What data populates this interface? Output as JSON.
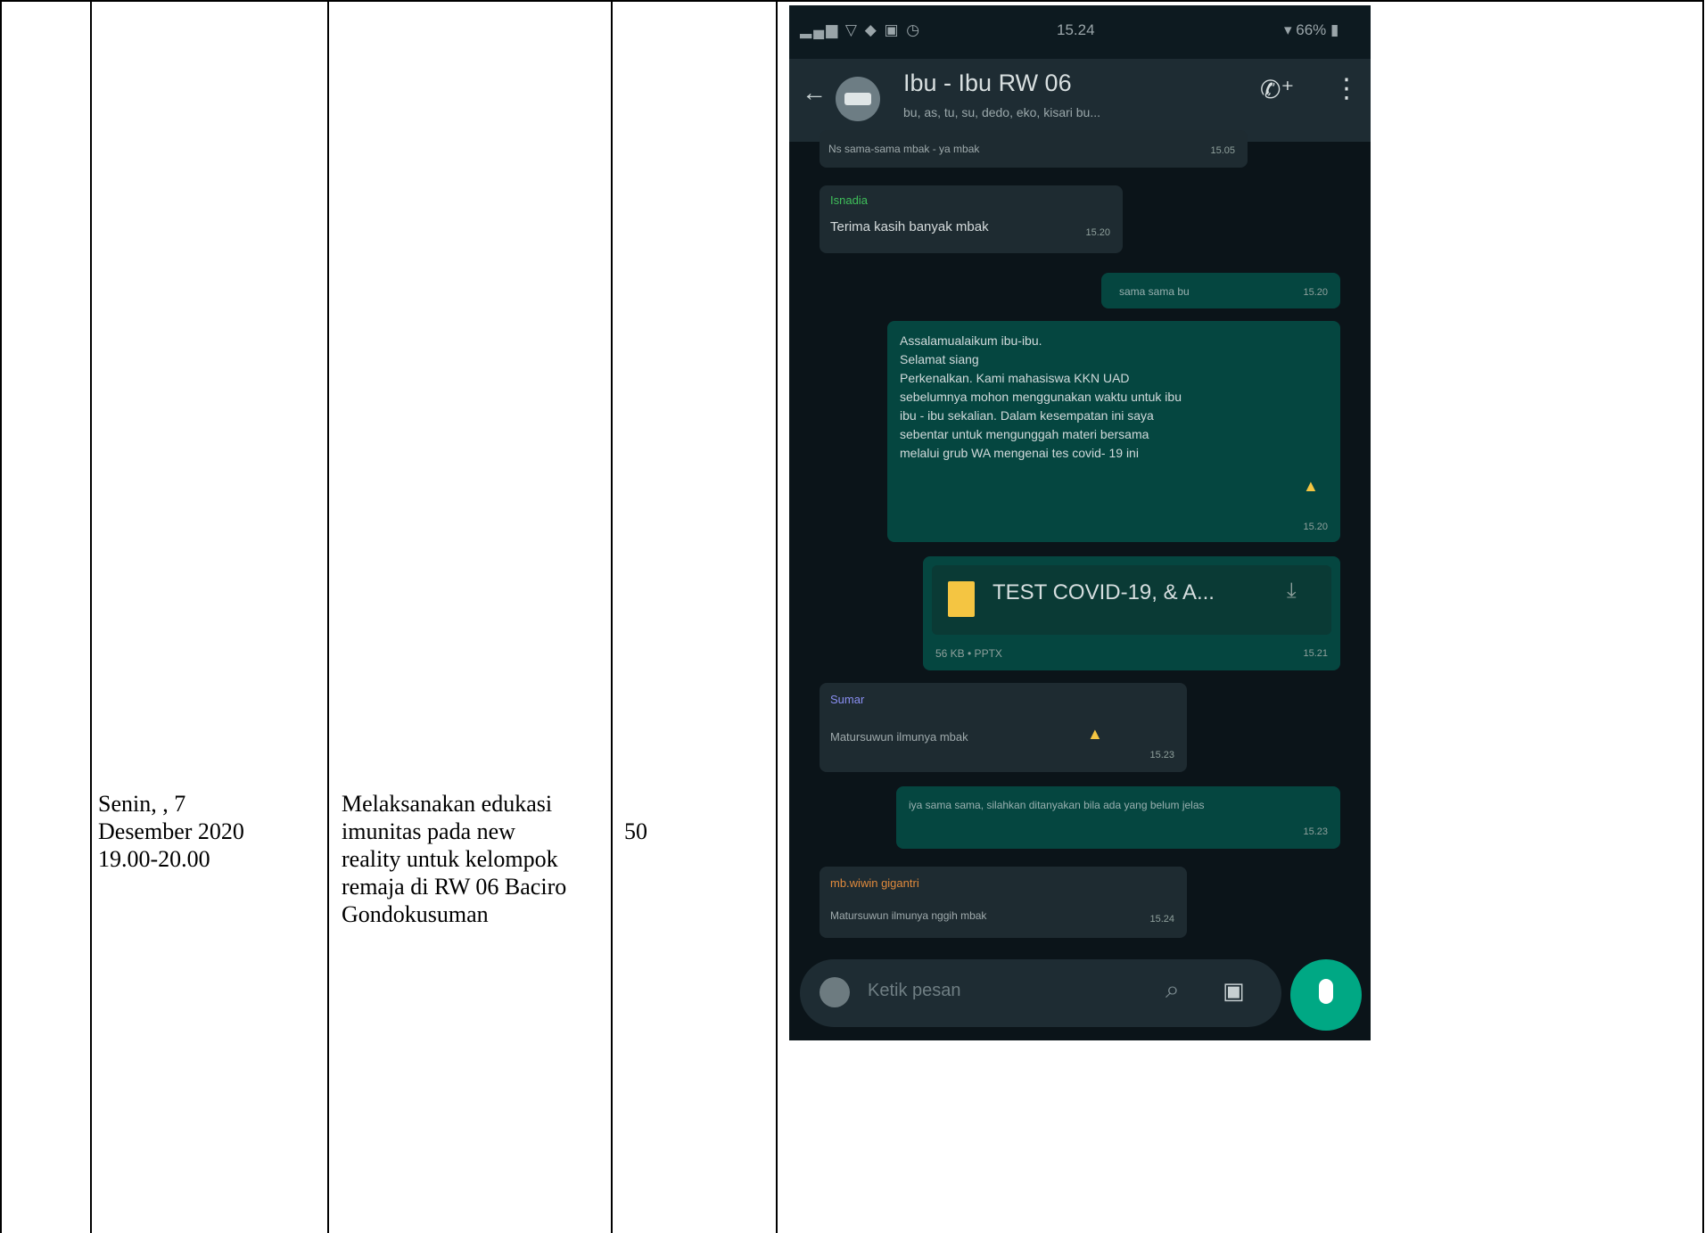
{
  "table": {
    "date": "Senin, , 7\nDesember 2020\n19.00-20.00",
    "activity": "Melaksanakan edukasi\nimunitas pada new\nreality untuk kelompok\nremaja di RW 06 Baciro\nGondokusuman",
    "count": "50"
  },
  "chat": {
    "status_time": "15.24",
    "status_battery": "66%",
    "group_name": "Ibu - Ibu RW 06",
    "group_members": "bu, as, tu, su, dedo, eko, kisari bu...",
    "messages": [
      {
        "text": "Ns sama-sama mbak - ya mbak",
        "time": "15.05"
      },
      {
        "sender": "Isnadia",
        "text": "Terima kasih banyak mbak",
        "time": "15.20"
      },
      {
        "text": "sama sama bu",
        "time": "15.20"
      },
      {
        "text": "Assalamualaikum ibu-ibu.\nSelamat siang\nPerkenalkan. Kami mahasiswa KKN UAD\nsebelumnya mohon menggunakan waktu untuk ibu\nibu - ibu sekalian. Dalam kesempatan ini saya\nsebentar untuk mengunggah materi bersama\nmelalui grub WA mengenai tes covid- 19 ini",
        "time": "15.20"
      },
      {
        "file_name": "TEST COVID-19, & A...",
        "file_meta": "56 KB • PPTX",
        "time": "15.21"
      },
      {
        "sender": "Sumar",
        "text": "Matursuwun ilmunya mbak",
        "time": "15.23"
      },
      {
        "text": "iya sama sama, silahkan ditanyakan bila ada yang belum jelas",
        "time": "15.23"
      },
      {
        "sender": "mb.wiwin gigantri",
        "text": "Matursuwun ilmunya nggih mbak",
        "time": "15.24"
      }
    ],
    "input_placeholder": "Ketik pesan"
  },
  "colors": {
    "chat_bg": "#0b1419",
    "outgoing_bubble": "#054640",
    "incoming_bubble": "#1e2b31",
    "accent_green": "#00a884",
    "file_icon": "#f4c542"
  }
}
